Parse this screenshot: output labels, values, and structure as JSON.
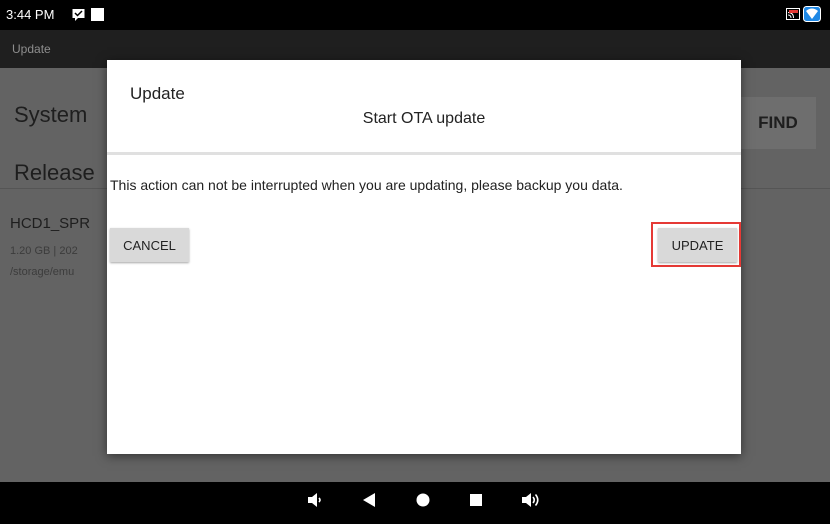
{
  "status_bar": {
    "time": "3:44 PM",
    "icons": [
      "message-icon",
      "blank-notification-icon",
      "cast-icon",
      "wifi-icon"
    ]
  },
  "app_bar": {
    "title": "Update"
  },
  "background": {
    "system_label": "System",
    "find_label": "FIND",
    "release_label": "Release",
    "file_name": "HCD1_SPR",
    "file_meta": "1.20 GB | 202",
    "file_path": "/storage/emu"
  },
  "dialog": {
    "title": "Update",
    "subtitle": "Start OTA update",
    "message": "This action can not be interrupted when you are updating, please backup you data.",
    "cancel_label": "CANCEL",
    "update_label": "UPDATE"
  },
  "nav_bar": {
    "icons": [
      "volume-down-icon",
      "back-icon",
      "home-icon",
      "recents-icon",
      "volume-up-icon"
    ]
  },
  "colors": {
    "highlight": "#e53935",
    "dialog_bg": "#ffffff",
    "button_bg": "#d9d9d9"
  }
}
